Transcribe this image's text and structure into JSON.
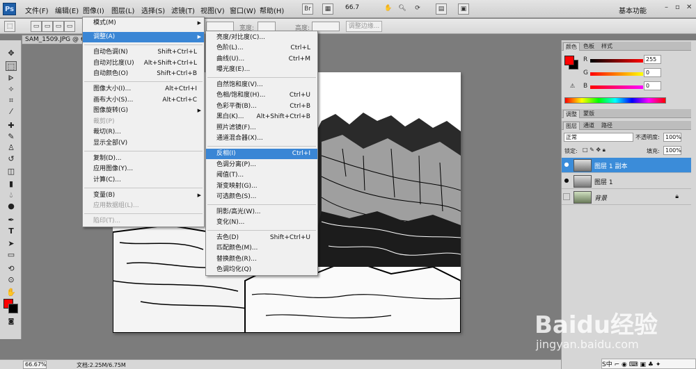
{
  "menubar": {
    "logo": "Ps",
    "items": [
      "文件(F)",
      "编辑(E)",
      "图像(I)",
      "图层(L)",
      "选择(S)",
      "滤镜(T)",
      "视图(V)",
      "窗口(W)",
      "帮助(H)"
    ],
    "zoom": "66.7",
    "workspace": "基本功能",
    "win_controls": [
      "–",
      "▫",
      "✕"
    ]
  },
  "options": {
    "width_label": "宽度:",
    "height_label": "高度:",
    "refine_button": "调整边缘..."
  },
  "document": {
    "tab_title": "SAM_1509.JPG @ 66"
  },
  "status": {
    "zoom": "66.67%",
    "doc_size": "文档:2.25M/6.75M"
  },
  "image_menu": {
    "items": [
      {
        "label": "模式(M)",
        "shortcut": "",
        "submenu": true
      },
      {
        "label": "调整(A)",
        "shortcut": "",
        "submenu": true,
        "highlight": true
      },
      {
        "label": "自动色调(N)",
        "shortcut": "Shift+Ctrl+L"
      },
      {
        "label": "自动对比度(U)",
        "shortcut": "Alt+Shift+Ctrl+L"
      },
      {
        "label": "自动颜色(O)",
        "shortcut": "Shift+Ctrl+B"
      },
      {
        "label": "图像大小(I)...",
        "shortcut": "Alt+Ctrl+I"
      },
      {
        "label": "画布大小(S)...",
        "shortcut": "Alt+Ctrl+C"
      },
      {
        "label": "图像旋转(G)",
        "shortcut": "",
        "submenu": true
      },
      {
        "label": "裁剪(P)",
        "shortcut": "",
        "disabled": true
      },
      {
        "label": "裁切(R)...",
        "shortcut": ""
      },
      {
        "label": "显示全部(V)",
        "shortcut": ""
      },
      {
        "label": "复制(D)...",
        "shortcut": ""
      },
      {
        "label": "应用图像(Y)...",
        "shortcut": ""
      },
      {
        "label": "计算(C)...",
        "shortcut": ""
      },
      {
        "label": "变量(B)",
        "shortcut": "",
        "submenu": true
      },
      {
        "label": "应用数据组(L)...",
        "shortcut": "",
        "disabled": true
      },
      {
        "label": "陷印(T)...",
        "shortcut": "",
        "disabled": true
      }
    ]
  },
  "adjust_menu": {
    "items": [
      {
        "label": "亮度/对比度(C)...",
        "shortcut": ""
      },
      {
        "label": "色阶(L)...",
        "shortcut": "Ctrl+L"
      },
      {
        "label": "曲线(U)...",
        "shortcut": "Ctrl+M"
      },
      {
        "label": "曝光度(E)...",
        "shortcut": ""
      },
      {
        "label": "自然饱和度(V)...",
        "shortcut": ""
      },
      {
        "label": "色相/饱和度(H)...",
        "shortcut": "Ctrl+U"
      },
      {
        "label": "色彩平衡(B)...",
        "shortcut": "Ctrl+B"
      },
      {
        "label": "黑白(K)...",
        "shortcut": "Alt+Shift+Ctrl+B"
      },
      {
        "label": "照片滤镜(F)...",
        "shortcut": ""
      },
      {
        "label": "通道混合器(X)...",
        "shortcut": ""
      },
      {
        "label": "反相(I)",
        "shortcut": "Ctrl+I",
        "highlight": true
      },
      {
        "label": "色调分离(P)...",
        "shortcut": ""
      },
      {
        "label": "阈值(T)...",
        "shortcut": ""
      },
      {
        "label": "渐变映射(G)...",
        "shortcut": ""
      },
      {
        "label": "可选颜色(S)...",
        "shortcut": ""
      },
      {
        "label": "阴影/高光(W)...",
        "shortcut": ""
      },
      {
        "label": "变化(N)...",
        "shortcut": ""
      },
      {
        "label": "去色(D)",
        "shortcut": "Shift+Ctrl+U"
      },
      {
        "label": "匹配颜色(M)...",
        "shortcut": ""
      },
      {
        "label": "替换颜色(R)...",
        "shortcut": ""
      },
      {
        "label": "色调均化(Q)",
        "shortcut": ""
      }
    ]
  },
  "color_panel": {
    "tabs": [
      "颜色",
      "色板",
      "样式"
    ],
    "r_label": "R",
    "g_label": "G",
    "b_label": "B",
    "r": "255",
    "g": "0",
    "b": "0"
  },
  "adjust_panel": {
    "tabs": [
      "调整",
      "蒙版"
    ]
  },
  "layers_panel": {
    "tabs": [
      "图层",
      "通道",
      "路径"
    ],
    "blend_mode": "正常",
    "opacity_label": "不透明度:",
    "opacity": "100%",
    "lock_label": "锁定:",
    "fill_label": "填充:",
    "fill": "100%",
    "layers": [
      {
        "name": "图层 1 副本",
        "selected": true
      },
      {
        "name": "图层 1",
        "selected": false
      },
      {
        "name": "背景",
        "selected": false,
        "locked": true
      }
    ]
  },
  "watermark": {
    "text": "Baidu经验",
    "url": "jingyan.baidu.com"
  },
  "tray": {
    "text": "S中 ⌐ ◉ ⌨ ▣ ♣ ✦"
  }
}
